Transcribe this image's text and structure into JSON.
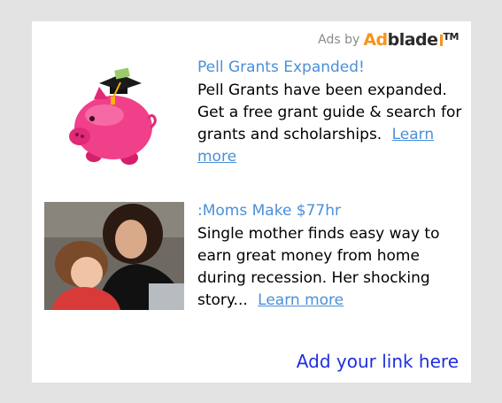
{
  "header": {
    "ads_by_label": "Ads by",
    "logo_text_ad": "Ad",
    "logo_text_blade": "blade",
    "logo_tm": "TM"
  },
  "ads": [
    {
      "title": "Pell Grants Expanded!",
      "description": "Pell Grants have been expanded. Get a free grant guide & search for grants and scholarships.",
      "link_text": "Learn more",
      "image": "piggy-bank-graduation-cap"
    },
    {
      "title": ":Moms Make $77hr",
      "description": "Single mother finds easy way to earn great money from home during recession. Her shocking story...",
      "link_text": "Learn more",
      "image": "mother-and-child-at-laptop"
    }
  ],
  "footer": {
    "add_link_text": "Add your link here"
  },
  "colors": {
    "background": "#e3e3e3",
    "panel": "#ffffff",
    "title_link": "#4b8fd7",
    "footer_link": "#1f2fe0",
    "logo_orange": "#f7941d"
  }
}
